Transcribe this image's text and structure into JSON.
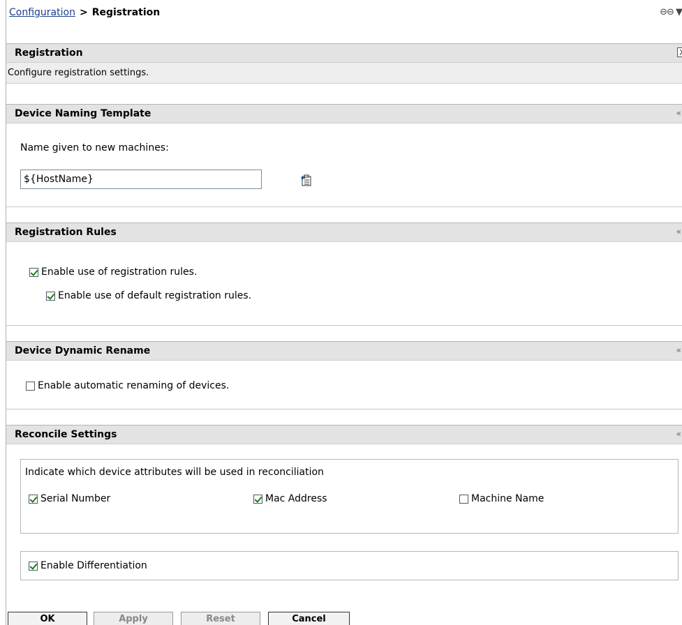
{
  "breadcrumb": {
    "parent": "Configuration",
    "separator": ">",
    "current": "Registration"
  },
  "top_tools": {
    "link_glyph": "⊖⊖",
    "menu_glyph": "▼"
  },
  "header": {
    "title": "Registration",
    "close_glyph": "X",
    "description": "Configure registration settings."
  },
  "naming": {
    "title": "Device Naming Template",
    "label": "Name given to new machines:",
    "value": "${HostName}"
  },
  "rules": {
    "title": "Registration Rules",
    "enable_rules": {
      "label": "Enable use of registration rules.",
      "checked": true
    },
    "enable_default_rules": {
      "label": "Enable use of default registration rules.",
      "checked": true
    }
  },
  "rename": {
    "title": "Device Dynamic Rename",
    "enable_rename": {
      "label": "Enable automatic renaming of devices.",
      "checked": false
    }
  },
  "reconcile": {
    "title": "Reconcile Settings",
    "instruction": "Indicate which device attributes will be used in reconciliation",
    "serial": {
      "label": "Serial Number",
      "checked": true
    },
    "mac": {
      "label": "Mac Address",
      "checked": true
    },
    "machine_name": {
      "label": "Machine Name",
      "checked": false
    },
    "differentiation": {
      "label": "Enable Differentiation",
      "checked": true
    }
  },
  "collapse_glyph": "«",
  "buttons": {
    "ok": "OK",
    "apply": "Apply",
    "reset": "Reset",
    "cancel": "Cancel"
  },
  "colors": {
    "link": "#1b3f8f",
    "section_bar": "#e3e3e3",
    "check": "#1a7a1a"
  }
}
